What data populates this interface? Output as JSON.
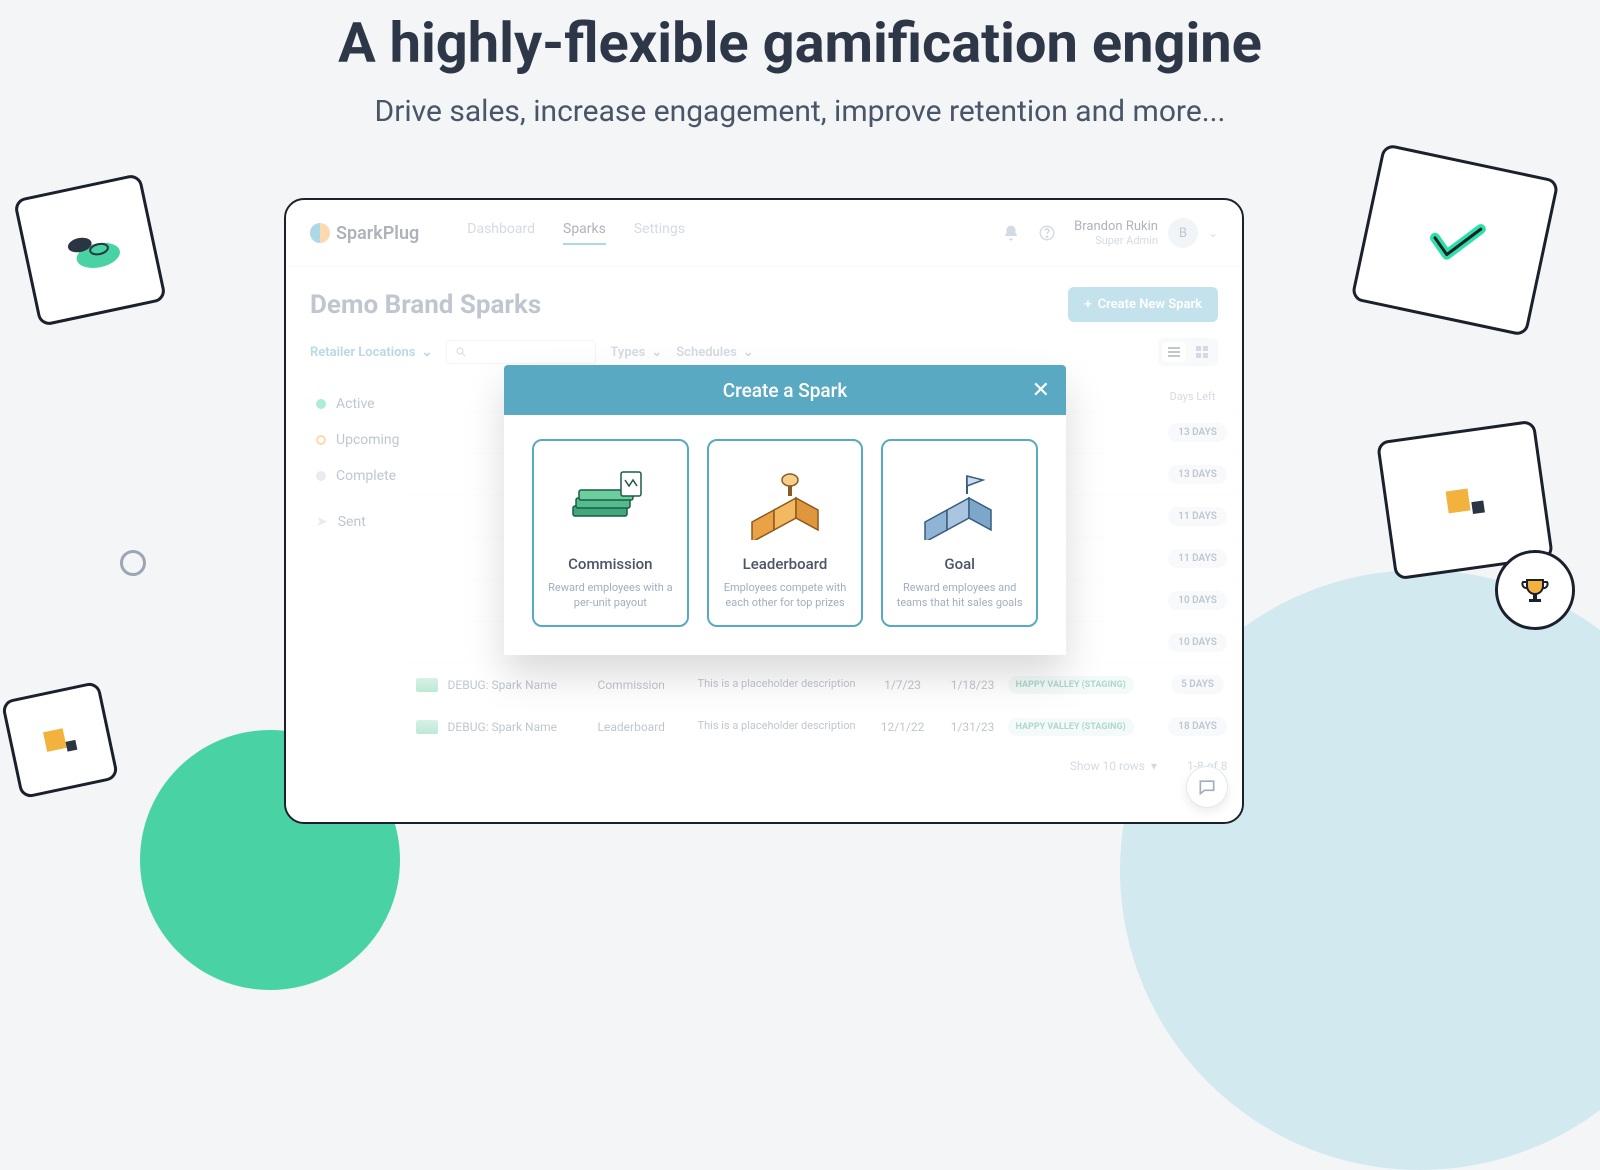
{
  "hero": {
    "title": "A highly-flexible gamification engine",
    "subtitle": "Drive sales, increase engagement, improve retention and more..."
  },
  "brand": "SparkPlug",
  "nav": {
    "dashboard": "Dashboard",
    "sparks": "Sparks",
    "settings": "Settings"
  },
  "user": {
    "name": "Brandon Rukin",
    "role": "Super Admin",
    "initial": "B"
  },
  "page": {
    "title": "Demo Brand Sparks",
    "create_btn": "Create New Spark"
  },
  "filters": {
    "locations": "Retailer Locations",
    "types": "Types",
    "schedules": "Schedules"
  },
  "sidebar": {
    "active": "Active",
    "upcoming": "Upcoming",
    "complete": "Complete",
    "sent": "Sent"
  },
  "table": {
    "head_daysleft": "Days Left",
    "rows": [
      {
        "days": "13 DAYS"
      },
      {
        "days": "13 DAYS"
      },
      {
        "days": "11 DAYS"
      },
      {
        "days": "11 DAYS"
      },
      {
        "days": "10 DAYS"
      },
      {
        "days": "10 DAYS"
      },
      {
        "name": "DEBUG: Spark Name",
        "type": "Commission",
        "desc": "This is a placeholder description",
        "d1": "1/7/23",
        "d2": "1/18/23",
        "loc": "HAPPY VALLEY (STAGING)",
        "days": "5 DAYS"
      },
      {
        "name": "DEBUG: Spark Name",
        "type": "Leaderboard",
        "desc": "This is a placeholder description",
        "d1": "12/1/22",
        "d2": "1/31/23",
        "loc": "HAPPY VALLEY (STAGING)",
        "days": "18 DAYS"
      }
    ],
    "show_rows": "Show 10 rows",
    "range": "1-8 of 8"
  },
  "modal": {
    "title": "Create a Spark",
    "cards": [
      {
        "title": "Commission",
        "desc": "Reward employees with a per-unit payout"
      },
      {
        "title": "Leaderboard",
        "desc": "Employees compete with each other for top prizes"
      },
      {
        "title": "Goal",
        "desc": "Reward employees and teams that hit sales goals"
      }
    ]
  }
}
